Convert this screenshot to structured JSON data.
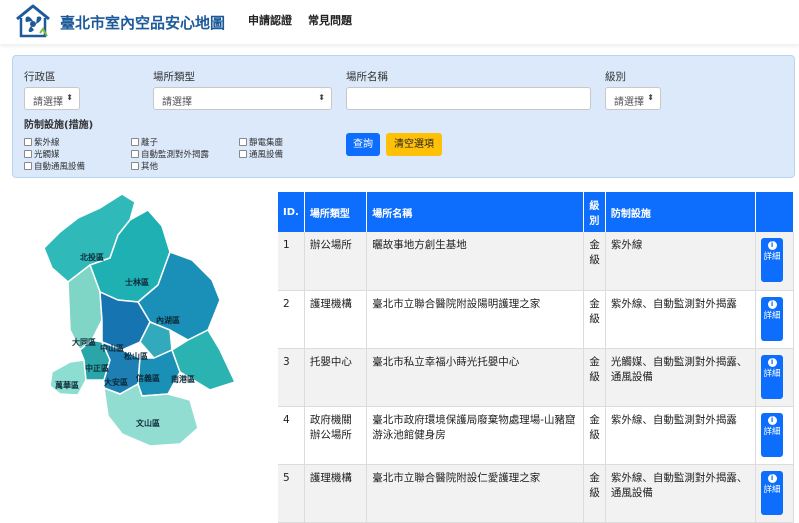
{
  "header": {
    "title": "臺北市室內空品安心地圖",
    "nav": [
      "申請認證",
      "常見問題"
    ]
  },
  "filters": {
    "district_label": "行政區",
    "district_value": "請選擇",
    "venue_type_label": "場所類型",
    "venue_type_value": "請選擇",
    "venue_name_label": "場所名稱",
    "venue_name_value": "",
    "level_label": "級別",
    "level_value": "請選擇",
    "measures_label": "防制設施(措施)",
    "measures": [
      "紫外線",
      "光觸媒",
      "自動通風設備",
      "離子",
      "自動監測對外揭露",
      "其他",
      "靜電集塵",
      "通風設備"
    ],
    "search_label": "查詢",
    "clear_label": "清空選項"
  },
  "map": {
    "districts": [
      "北投區",
      "士林區",
      "內湖區",
      "大同區",
      "中山區",
      "松山區",
      "萬華區",
      "中正區",
      "大安區",
      "信義區",
      "南港區",
      "文山區"
    ]
  },
  "table": {
    "headers": [
      "ID.",
      "場所類型",
      "場所名稱",
      "級別",
      "防制設施",
      ""
    ],
    "detail_label": "詳細",
    "rows": [
      {
        "id": "1",
        "type": "辦公場所",
        "name": "曬故事地方創生基地",
        "level": "金級",
        "measures": "紫外線"
      },
      {
        "id": "2",
        "type": "護理機構",
        "name": "臺北市立聯合醫院附設陽明護理之家",
        "level": "金級",
        "measures": "紫外線、自動監測對外揭露"
      },
      {
        "id": "3",
        "type": "托嬰中心",
        "name": "臺北市私立幸福小蒔光托嬰中心",
        "level": "金級",
        "measures": "光觸媒、自動監測對外揭露、通風設備"
      },
      {
        "id": "4",
        "type": "政府機關辦公場所",
        "name": "臺北市政府環境保護局廢棄物處理場-山豬窟游泳池館健身房",
        "level": "金級",
        "measures": "紫外線、自動監測對外揭露"
      },
      {
        "id": "5",
        "type": "護理機構",
        "name": "臺北市立聯合醫院附設仁愛護理之家",
        "level": "金級",
        "measures": "紫外線、自動監測對外揭露、通風設備"
      }
    ]
  }
}
